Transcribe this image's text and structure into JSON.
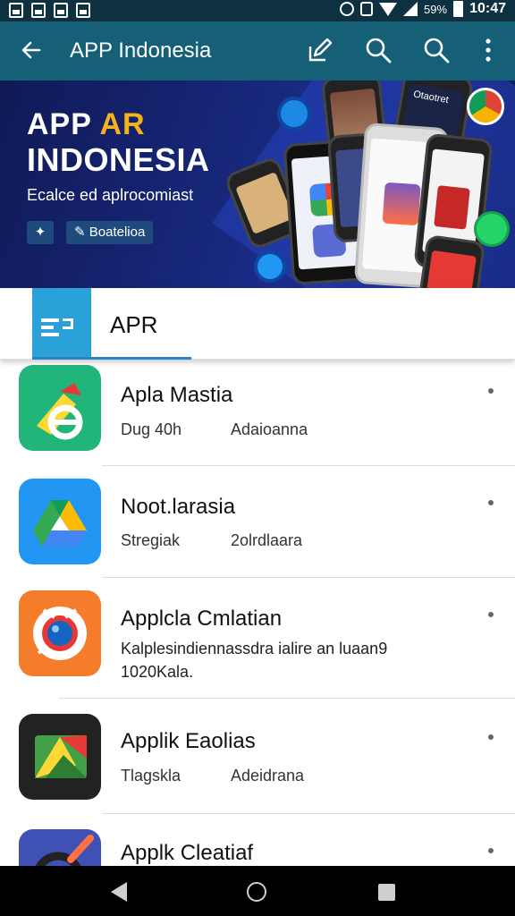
{
  "status_bar": {
    "battery_percent": "59%",
    "time": "10:47"
  },
  "app_bar": {
    "title": "APP Indonesia",
    "icons": [
      "back-arrow-icon",
      "edit-icon",
      "search-icon",
      "search-icon",
      "overflow-menu-icon"
    ]
  },
  "banner": {
    "title_part1": "APP",
    "title_part2": "AR",
    "title_line2": "INDONESIA",
    "subtitle": "Ecalce ed aplrocomiast",
    "button_label": "Boatelioa",
    "phone_label": "Otaotret"
  },
  "tab": {
    "label": "APR"
  },
  "apps": [
    {
      "name": "Apla Mastia",
      "meta1": "Dug 40h",
      "meta2": "Adaioanna"
    },
    {
      "name": "Noot.larasia",
      "meta1": "Stregiak",
      "meta2": "2olrdlaara"
    },
    {
      "name": "Applcla Cmlatian",
      "desc_line1": "Kalplesindiennassdra ialire an luaan9",
      "desc_line2": "1020Kala."
    },
    {
      "name": "Applik Eaolias",
      "meta1": "Tlagskla",
      "meta2": "Adeidrana"
    },
    {
      "name": "Applk Cleatiaf"
    }
  ],
  "colors": {
    "status_bar": "#0d3140",
    "app_bar": "#155f77",
    "tab_accent": "#2aa1d8",
    "banner_accent": "#f3b21b"
  }
}
